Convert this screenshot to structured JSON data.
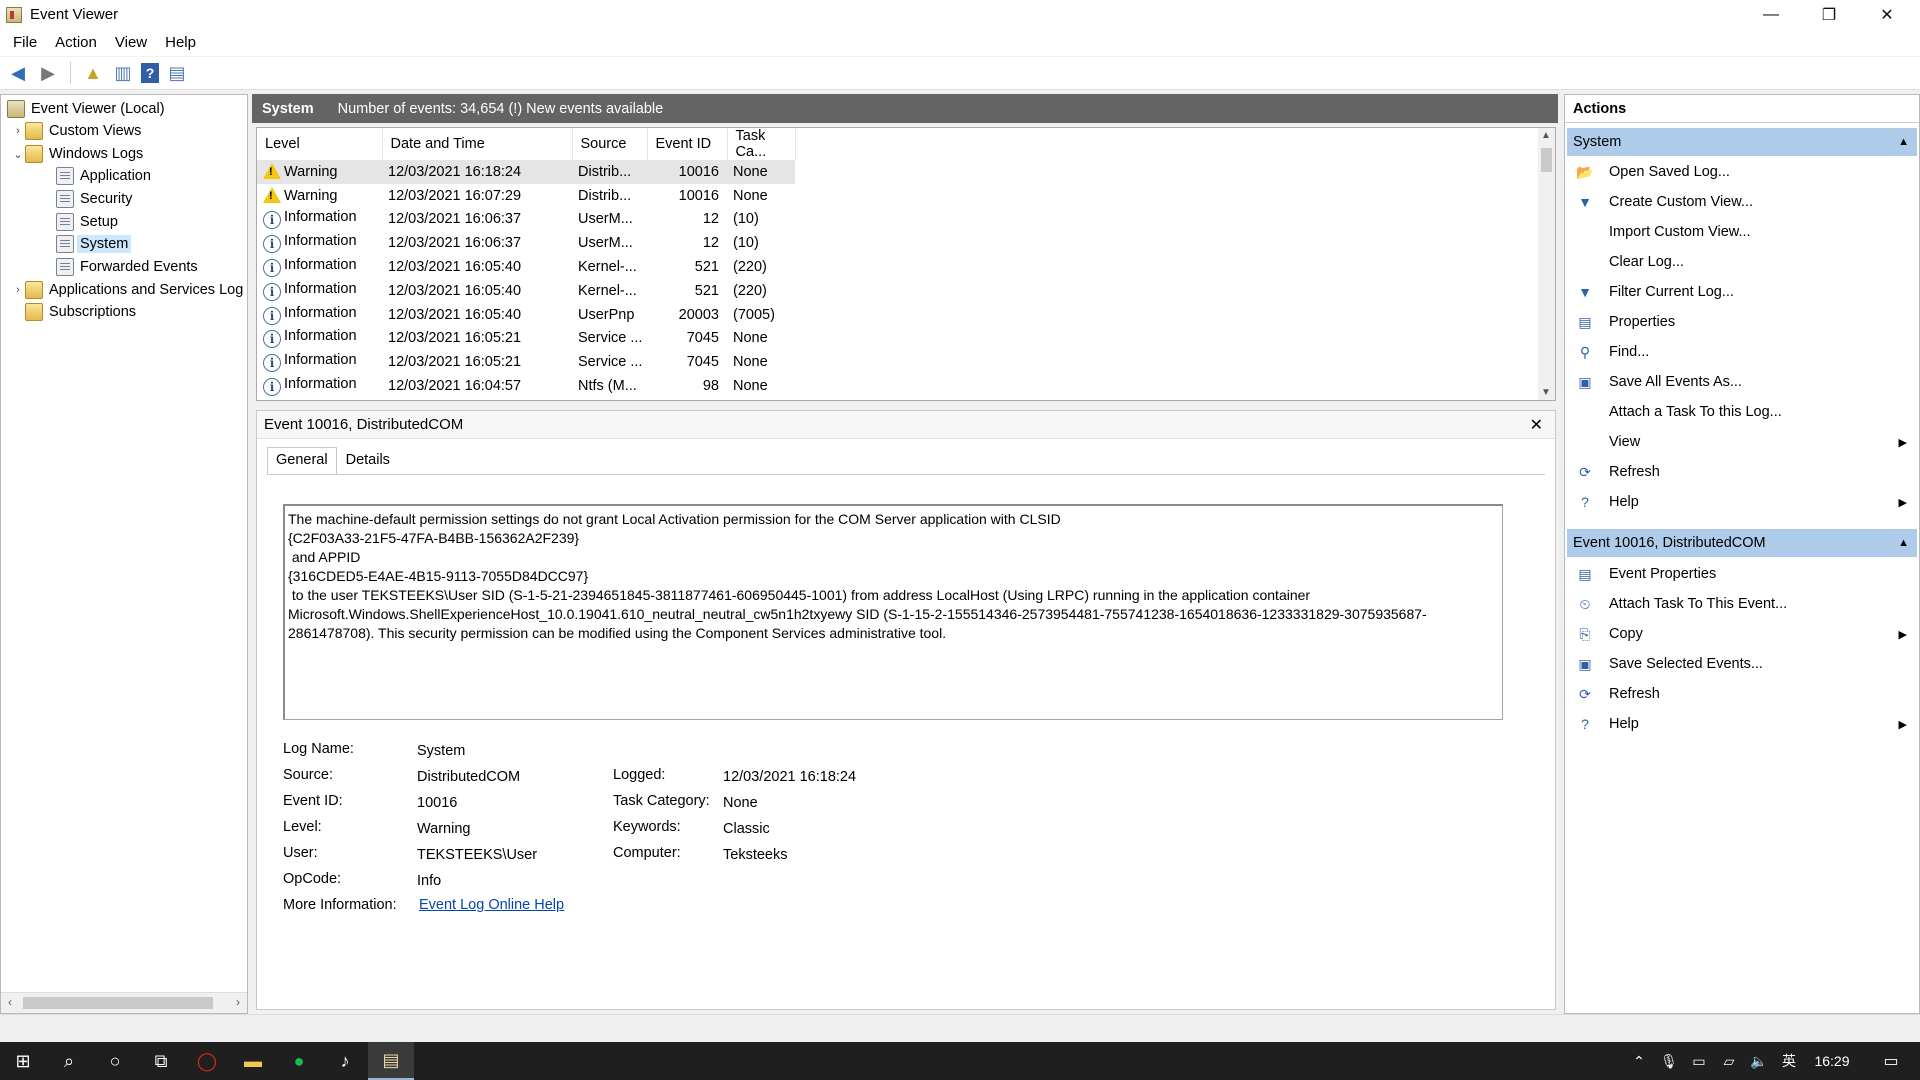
{
  "window": {
    "title": "Event Viewer",
    "minimize": "—",
    "restore": "❐",
    "close": "✕"
  },
  "menu": [
    "File",
    "Action",
    "View",
    "Help"
  ],
  "tree": {
    "root": "Event Viewer (Local)",
    "custom_views": "Custom Views",
    "windows_logs": "Windows Logs",
    "application": "Application",
    "security": "Security",
    "setup": "Setup",
    "system": "System",
    "forwarded": "Forwarded Events",
    "app_services": "Applications and Services Log",
    "subscriptions": "Subscriptions"
  },
  "log_header": {
    "name": "System",
    "info": "Number of events: 34,654 (!) New events available"
  },
  "columns": [
    "Level",
    "Date and Time",
    "Source",
    "Event ID",
    "Task Ca..."
  ],
  "events": [
    {
      "level": "Warning",
      "type": "warn",
      "date": "12/03/2021 16:18:24",
      "source": "Distrib...",
      "id": "10016",
      "task": "None"
    },
    {
      "level": "Warning",
      "type": "warn",
      "date": "12/03/2021 16:07:29",
      "source": "Distrib...",
      "id": "10016",
      "task": "None"
    },
    {
      "level": "Information",
      "type": "info",
      "date": "12/03/2021 16:06:37",
      "source": "UserM...",
      "id": "12",
      "task": "(10)"
    },
    {
      "level": "Information",
      "type": "info",
      "date": "12/03/2021 16:06:37",
      "source": "UserM...",
      "id": "12",
      "task": "(10)"
    },
    {
      "level": "Information",
      "type": "info",
      "date": "12/03/2021 16:05:40",
      "source": "Kernel-...",
      "id": "521",
      "task": "(220)"
    },
    {
      "level": "Information",
      "type": "info",
      "date": "12/03/2021 16:05:40",
      "source": "Kernel-...",
      "id": "521",
      "task": "(220)"
    },
    {
      "level": "Information",
      "type": "info",
      "date": "12/03/2021 16:05:40",
      "source": "UserPnp",
      "id": "20003",
      "task": "(7005)"
    },
    {
      "level": "Information",
      "type": "info",
      "date": "12/03/2021 16:05:21",
      "source": "Service ...",
      "id": "7045",
      "task": "None"
    },
    {
      "level": "Information",
      "type": "info",
      "date": "12/03/2021 16:05:21",
      "source": "Service ...",
      "id": "7045",
      "task": "None"
    },
    {
      "level": "Information",
      "type": "info",
      "date": "12/03/2021 16:04:57",
      "source": "Ntfs (M...",
      "id": "98",
      "task": "None"
    }
  ],
  "detail": {
    "title": "Event 10016, DistributedCOM",
    "tab_general": "General",
    "tab_details": "Details",
    "message_lines": [
      "The machine-default permission settings do not grant Local Activation permission for the COM Server application with CLSID",
      "{C2F03A33-21F5-47FA-B4BB-156362A2F239}",
      " and APPID",
      "{316CDED5-E4AE-4B15-9113-7055D84DCC97}",
      " to the user TEKSTEEKS\\User SID (S-1-5-21-2394651845-3811877461-606950445-1001) from address LocalHost (Using LRPC) running in the application container",
      "Microsoft.Windows.ShellExperienceHost_10.0.19041.610_neutral_neutral_cw5n1h2txyewy SID (S-1-15-2-155514346-2573954481-755741238-1654018636-1233331829-3075935687-",
      "2861478708). This security permission can be modified using the Component Services administrative tool."
    ],
    "labels": {
      "log_name": "Log Name:",
      "source": "Source:",
      "event_id": "Event ID:",
      "level": "Level:",
      "user": "User:",
      "opcode": "OpCode:",
      "more_info": "More Information:",
      "logged": "Logged:",
      "task_category": "Task Category:",
      "keywords": "Keywords:",
      "computer": "Computer:"
    },
    "values": {
      "log_name": "System",
      "source": "DistributedCOM",
      "event_id": "10016",
      "level": "Warning",
      "user": "TEKSTEEKS\\User",
      "opcode": "Info",
      "more_info": "Event Log Online Help",
      "logged": "12/03/2021 16:18:24",
      "task_category": "None",
      "keywords": "Classic",
      "computer": "Teksteeks"
    }
  },
  "actions": {
    "title": "Actions",
    "section1": "System",
    "items1": [
      {
        "label": "Open Saved Log...",
        "icon": "folder-open-icon",
        "glyph": "📂",
        "sub": false
      },
      {
        "label": "Create Custom View...",
        "icon": "filter-create-icon",
        "glyph": "▼",
        "sub": false
      },
      {
        "label": "Import Custom View...",
        "icon": "",
        "glyph": "",
        "sub": false
      },
      {
        "label": "Clear Log...",
        "icon": "",
        "glyph": "",
        "sub": false
      },
      {
        "label": "Filter Current Log...",
        "icon": "filter-icon",
        "glyph": "▼",
        "sub": false
      },
      {
        "label": "Properties",
        "icon": "properties-icon",
        "glyph": "▤",
        "sub": false
      },
      {
        "label": "Find...",
        "icon": "binoculars-icon",
        "glyph": "⚲",
        "sub": false
      },
      {
        "label": "Save All Events As...",
        "icon": "save-icon",
        "glyph": "▣",
        "sub": false
      },
      {
        "label": "Attach a Task To this Log...",
        "icon": "",
        "glyph": "",
        "sub": false
      },
      {
        "label": "View",
        "icon": "",
        "glyph": "",
        "sub": true
      },
      {
        "label": "Refresh",
        "icon": "refresh-icon",
        "glyph": "⟳",
        "sub": false
      },
      {
        "label": "Help",
        "icon": "help-icon",
        "glyph": "?",
        "sub": true
      }
    ],
    "section2": "Event 10016, DistributedCOM",
    "items2": [
      {
        "label": "Event Properties",
        "icon": "properties-icon",
        "glyph": "▤",
        "sub": false
      },
      {
        "label": "Attach Task To This Event...",
        "icon": "task-icon",
        "glyph": "⏲",
        "sub": false
      },
      {
        "label": "Copy",
        "icon": "copy-icon",
        "glyph": "⎘",
        "sub": true
      },
      {
        "label": "Save Selected Events...",
        "icon": "save-icon",
        "glyph": "▣",
        "sub": false
      },
      {
        "label": "Refresh",
        "icon": "refresh-icon",
        "glyph": "⟳",
        "sub": false
      },
      {
        "label": "Help",
        "icon": "help-icon",
        "glyph": "?",
        "sub": true
      }
    ]
  },
  "taskbar": {
    "clock": "16:29",
    "ime": "英"
  },
  "colors": {
    "header_bg": "#646464",
    "section_bg": "#aecbe9",
    "link": "#0645ad",
    "taskbar": "#1f1f1f"
  }
}
